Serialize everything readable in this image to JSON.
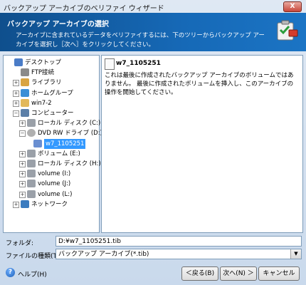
{
  "window": {
    "title": "バックアップ アーカイブのベリファイ ウィザード",
    "close_label": "X"
  },
  "banner": {
    "title": "バックアップ アーカイブの選択",
    "description": "アーカイブに含まれているデータをベリファイするには、下のツリーからバックアップ アーカイブを選択し［次へ］をクリックしてください。"
  },
  "tree": {
    "items": [
      {
        "label": "デスクトップ",
        "icon": "desktop-icon",
        "expander": ""
      },
      {
        "label": "FTP接続",
        "icon": "ftp-icon",
        "expander": ""
      },
      {
        "label": "ライブラリ",
        "icon": "library-icon",
        "expander": "+"
      },
      {
        "label": "ホームグループ",
        "icon": "homegroup-icon",
        "expander": "+"
      },
      {
        "label": "win7-2",
        "icon": "user-folder-icon",
        "expander": "+"
      },
      {
        "label": "コンピューター",
        "icon": "computer-icon",
        "expander": "−"
      },
      {
        "label": "ローカル ディスク (C:)",
        "icon": "drive-icon",
        "expander": "+"
      },
      {
        "label": "DVD RW ドライブ (D:) A",
        "icon": "dvd-icon",
        "expander": "−"
      },
      {
        "label": "w7_1105251",
        "icon": "archive-icon",
        "expander": ""
      },
      {
        "label": "ボリューム (E:)",
        "icon": "drive-icon",
        "expander": "+"
      },
      {
        "label": "ローカル ディスク (H:)",
        "icon": "drive-icon",
        "expander": "+"
      },
      {
        "label": "volume (I:)",
        "icon": "drive-icon",
        "expander": "+"
      },
      {
        "label": "volume (J:)",
        "icon": "drive-icon",
        "expander": "+"
      },
      {
        "label": "volume (L:)",
        "icon": "drive-icon",
        "expander": "+"
      },
      {
        "label": "ネットワーク",
        "icon": "network-icon",
        "expander": "+"
      }
    ]
  },
  "detail": {
    "title": "w7_1105251",
    "text": "これは最後に作成されたバックアップ アーカイブのボリュームではありません。 最後に作成されたボリュームを挿入し、このアーカイブの操作を開始してください。"
  },
  "form": {
    "folder_label": "フォルダ:",
    "folder_value": "D:¥w7_1105251.tib",
    "filetype_label": "ファイルの種類(T):",
    "filetype_value": "バックアップ アーカイブ(*.tib)"
  },
  "buttons": {
    "help": "ヘルプ(H)",
    "back": "＜戻る(B)",
    "next": "次へ(N) ＞",
    "cancel": "キャンセル"
  }
}
